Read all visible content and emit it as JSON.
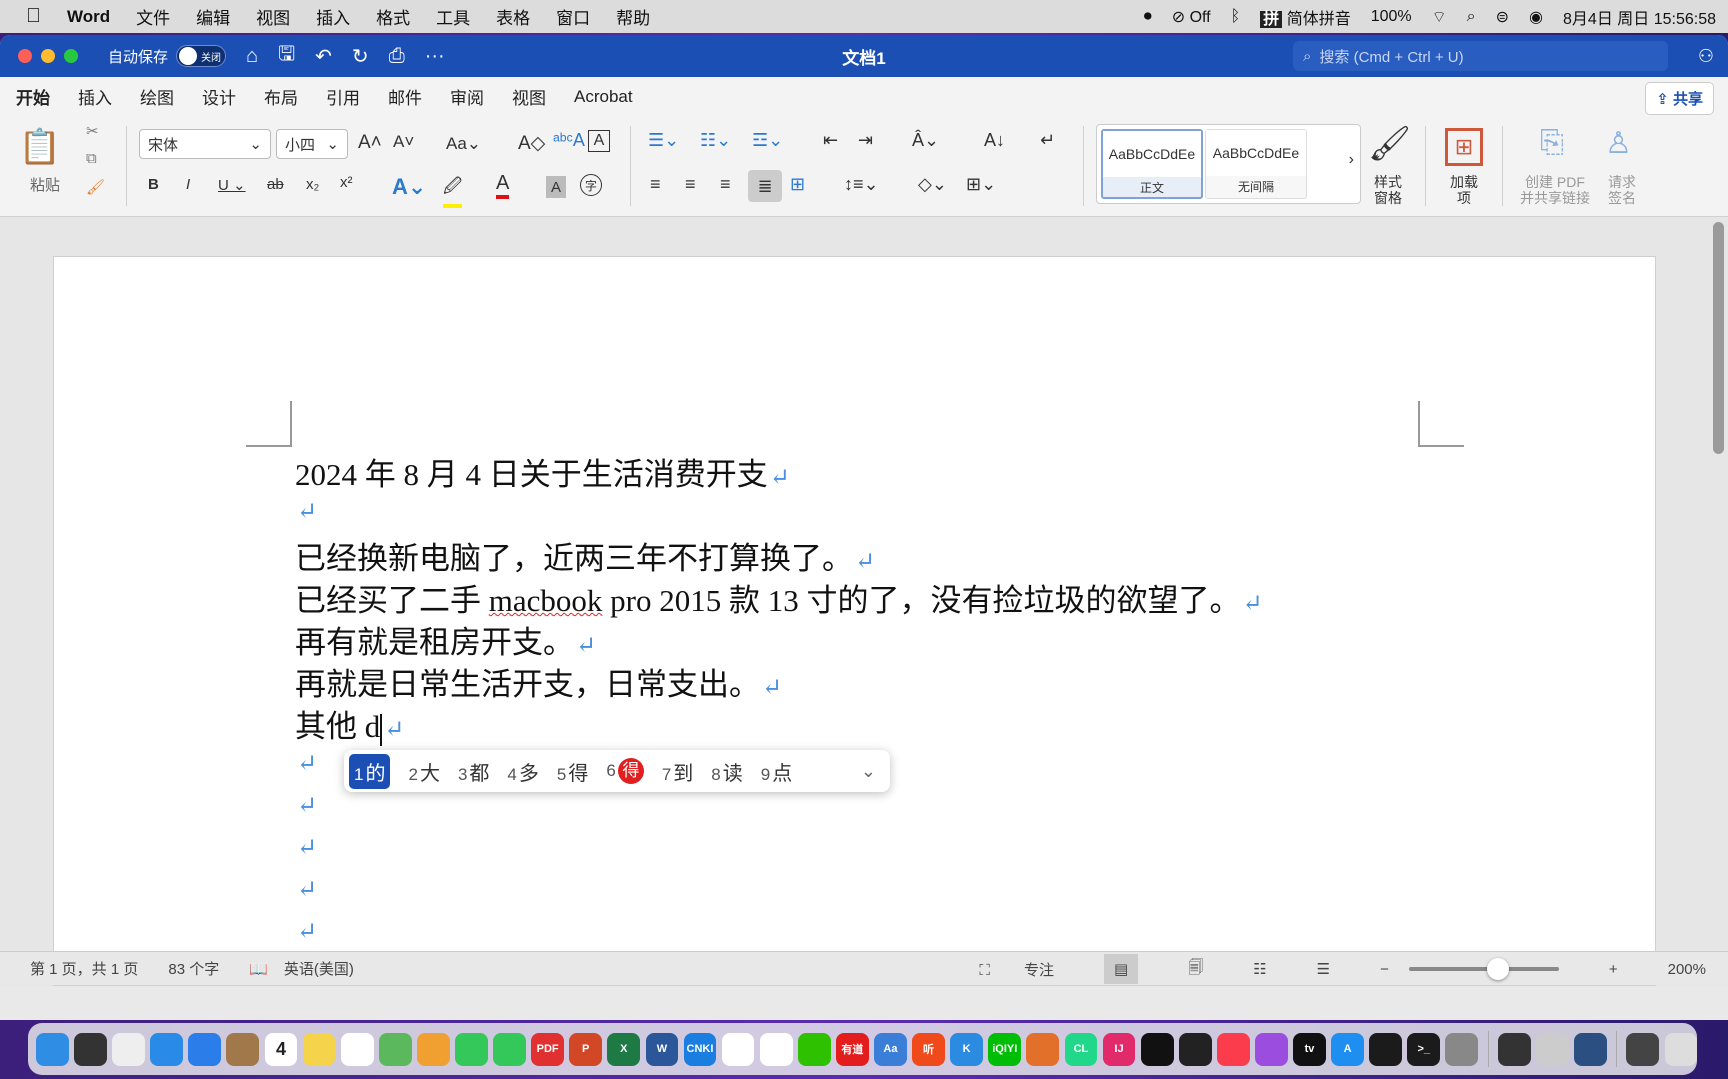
{
  "menubar": {
    "app": "Word",
    "items": [
      "文件",
      "编辑",
      "视图",
      "插入",
      "格式",
      "工具",
      "表格",
      "窗口",
      "帮助"
    ],
    "status": {
      "focus": "Off",
      "ime": "简体拼音",
      "battery": "100%",
      "datetime": "8月4日 周日  15:56:58"
    }
  },
  "titlebar": {
    "autosave_label": "自动保存",
    "autosave_state": "关闭",
    "title": "文档1",
    "search_placeholder": "搜索 (Cmd + Ctrl + U)"
  },
  "tabs": [
    {
      "label": "开始",
      "active": true
    },
    {
      "label": "插入"
    },
    {
      "label": "绘图"
    },
    {
      "label": "设计"
    },
    {
      "label": "布局"
    },
    {
      "label": "引用"
    },
    {
      "label": "邮件"
    },
    {
      "label": "审阅"
    },
    {
      "label": "视图"
    },
    {
      "label": "Acrobat"
    }
  ],
  "share_label": "共享",
  "ribbon": {
    "paste": "粘贴",
    "font": "宋体",
    "size": "小四",
    "change_case": "Aa",
    "styles": [
      {
        "preview": "AaBbCcDdEe",
        "name": "正文",
        "selected": true
      },
      {
        "preview": "AaBbCcDdEe",
        "name": "无间隔"
      }
    ],
    "styles_pane": "样式\n窗格",
    "addins": "加载\n项",
    "create_pdf": "创建 PDF\n并共享链接",
    "request_sign": "请求\n签名"
  },
  "document": {
    "lines": [
      {
        "text": "2024 年 8 月 4 日关于生活消费开支"
      },
      {
        "text": ""
      },
      {
        "text": "已经换新电脑了，近两三年不打算换了。"
      },
      {
        "text": "已经买了二手 ",
        "misspelled": "macbook",
        "after": " pro 2015 款 13 寸的了，没有捡垃圾的欲望了。"
      },
      {
        "text": "再有就是租房开支。"
      },
      {
        "text": "再就是日常生活开支，日常支出。"
      },
      {
        "text": "其他 d",
        "caret": true
      },
      {
        "text": ""
      },
      {
        "text": ""
      },
      {
        "text": ""
      },
      {
        "text": ""
      },
      {
        "text": ""
      }
    ],
    "paragraph_mark": "↵"
  },
  "ime": {
    "candidates": [
      {
        "n": "1",
        "c": "的"
      },
      {
        "n": "2",
        "c": "大"
      },
      {
        "n": "3",
        "c": "都"
      },
      {
        "n": "4",
        "c": "多"
      },
      {
        "n": "5",
        "c": "得"
      },
      {
        "n": "6",
        "c": "得",
        "badge": true
      },
      {
        "n": "7",
        "c": "到"
      },
      {
        "n": "8",
        "c": "读"
      },
      {
        "n": "9",
        "c": "点"
      }
    ]
  },
  "status": {
    "page": "第 1 页，共 1 页",
    "words": "83 个字",
    "language": "英语(美国)",
    "focus": "专注",
    "zoom": "200%",
    "zoom_percent": 200
  },
  "dock": [
    {
      "name": "finder",
      "c": "#2f8de4"
    },
    {
      "name": "siri",
      "c": "#333"
    },
    {
      "name": "launchpad",
      "c": "#eee"
    },
    {
      "name": "safari",
      "c": "#2a8ae8"
    },
    {
      "name": "mail",
      "c": "#2b7de9"
    },
    {
      "name": "contacts",
      "c": "#a0784a"
    },
    {
      "name": "calendar",
      "c": "#fff",
      "t": "4"
    },
    {
      "name": "notes",
      "c": "#f5d34a"
    },
    {
      "name": "reminders",
      "c": "#fff"
    },
    {
      "name": "maps",
      "c": "#5cb85c"
    },
    {
      "name": "photos",
      "c": "#f0a030"
    },
    {
      "name": "messages",
      "c": "#34c759"
    },
    {
      "name": "facetime",
      "c": "#34c759"
    },
    {
      "name": "pdf",
      "c": "#e03030",
      "t": "PDF"
    },
    {
      "name": "powerpoint",
      "c": "#d24726",
      "t": "P"
    },
    {
      "name": "excel",
      "c": "#1d7a45",
      "t": "X"
    },
    {
      "name": "word",
      "c": "#2b579a",
      "t": "W"
    },
    {
      "name": "cnki",
      "c": "#1a7de0",
      "t": "CNKI"
    },
    {
      "name": "baidu-netdisk",
      "c": "#fff"
    },
    {
      "name": "qq",
      "c": "#fff"
    },
    {
      "name": "wechat",
      "c": "#2dc100"
    },
    {
      "name": "youdao",
      "c": "#e31c1c",
      "t": "有道"
    },
    {
      "name": "dictionary",
      "c": "#3b7ed8",
      "t": "Aa"
    },
    {
      "name": "ting",
      "c": "#f04a1a",
      "t": "听"
    },
    {
      "name": "kugou",
      "c": "#2b8be0",
      "t": "K"
    },
    {
      "name": "iqiyi",
      "c": "#00be06",
      "t": "iQIYI"
    },
    {
      "name": "matlab",
      "c": "#e3702a"
    },
    {
      "name": "clion",
      "c": "#21d789",
      "t": "CL"
    },
    {
      "name": "intellij",
      "c": "#e02a6a",
      "t": "IJ"
    },
    {
      "name": "capcut",
      "c": "#111"
    },
    {
      "name": "robot",
      "c": "#222"
    },
    {
      "name": "music",
      "c": "#fa3c4c"
    },
    {
      "name": "podcasts",
      "c": "#9b4de0"
    },
    {
      "name": "appletv",
      "c": "#111",
      "t": "tv"
    },
    {
      "name": "appstore",
      "c": "#1e8ef0",
      "t": "A"
    },
    {
      "name": "activity-monitor",
      "c": "#1b1b1b"
    },
    {
      "name": "terminal",
      "c": "#1b1b1b",
      "t": ">_"
    },
    {
      "name": "system-settings",
      "c": "#888"
    },
    {
      "name": "calculator",
      "c": "#333"
    },
    {
      "name": "automator",
      "c": "#ccc"
    },
    {
      "name": "quicktime",
      "c": "#2a4f80"
    },
    {
      "name": "downloads",
      "c": "#444"
    },
    {
      "name": "trash",
      "c": "#ddd"
    }
  ]
}
